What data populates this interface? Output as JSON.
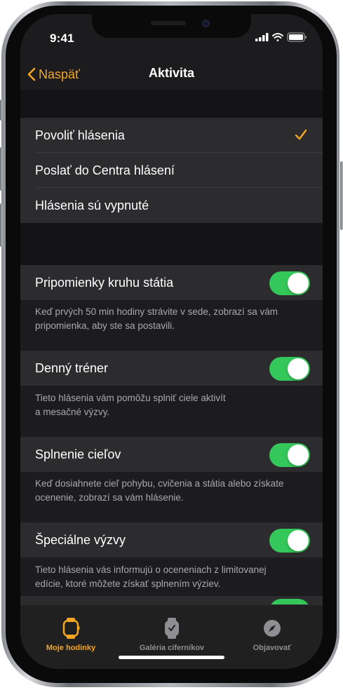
{
  "status_bar": {
    "time": "9:41"
  },
  "navbar": {
    "back_label": "Naspäť",
    "title": "Aktivita"
  },
  "alert_options": [
    {
      "label": "Povoliť hlásenia",
      "selected": true
    },
    {
      "label": "Poslať do Centra hlásení",
      "selected": false
    },
    {
      "label": "Hlásenia sú vypnuté",
      "selected": false
    }
  ],
  "toggles": [
    {
      "label": "Pripomienky kruhu státia",
      "on": true,
      "footnote_lines": [
        "Keď prvých 50 min hodiny strávite v sede, zobrazí sa vám",
        "pripomienka, aby ste sa postavili."
      ]
    },
    {
      "label": "Denný tréner",
      "on": true,
      "footnote_lines": [
        "Tieto hlásenia vám pomôžu splniť ciele aktivít",
        "a mesačné výzvy."
      ]
    },
    {
      "label": "Splnenie cieľov",
      "on": true,
      "footnote_lines": [
        "Keď dosiahnete cieľ pohybu, cvičenia a státia alebo získate",
        "ocenenie, zobrazí sa vám hlásenie."
      ]
    },
    {
      "label": "Špeciálne výzvy",
      "on": true,
      "footnote_lines": [
        "Tieto hlásenia vás informujú o oceneniach z limitovanej",
        "edície, ktoré môžete získať splnením výziev."
      ]
    }
  ],
  "tabbar": {
    "tabs": [
      {
        "label": "Moje hodinky",
        "icon": "watch-icon",
        "active": true
      },
      {
        "label": "Galéria ciferníkov",
        "icon": "watch-face-icon",
        "active": false
      },
      {
        "label": "Objavovať",
        "icon": "compass-icon",
        "active": false
      }
    ]
  },
  "colors": {
    "accent": "#f5a623",
    "toggle_on": "#34c759",
    "cell_bg": "#2c2c2e",
    "group_bg": "#1c1c1e",
    "tab_inactive": "#8e8e93"
  }
}
